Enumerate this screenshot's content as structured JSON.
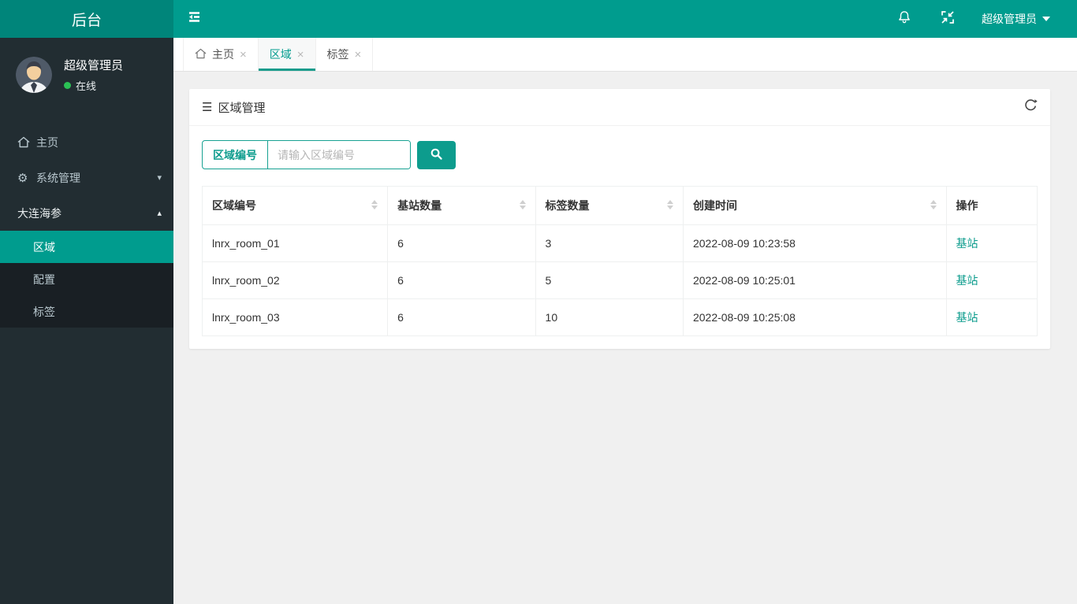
{
  "app": {
    "title": "后台"
  },
  "navbar": {
    "user_label": "超级管理员",
    "icons": {
      "menu_toggle": "outdent-lines",
      "notifications": "bell",
      "fullscreen": "compress-arrows",
      "user_caret": "caret-down"
    }
  },
  "sidebar": {
    "user": {
      "name": "超级管理员",
      "status": "在线"
    },
    "menu": [
      {
        "label": "主页",
        "icon": "home-icon"
      },
      {
        "label": "系统管理",
        "icon": "gear-icon",
        "caret": "down"
      },
      {
        "label": "大连海参",
        "caret": "up",
        "children": [
          {
            "label": "区域",
            "active": true
          },
          {
            "label": "配置",
            "active": false
          },
          {
            "label": "标签",
            "active": false
          }
        ]
      }
    ]
  },
  "tabs": [
    {
      "label": "主页",
      "home_icon": true,
      "active": false
    },
    {
      "label": "区域",
      "home_icon": false,
      "active": true
    },
    {
      "label": "标签",
      "home_icon": false,
      "active": false
    }
  ],
  "panel": {
    "title": "区域管理",
    "search": {
      "label": "区域编号",
      "placeholder": "请输入区域编号"
    },
    "table": {
      "columns": [
        {
          "label": "区域编号",
          "sortable": true
        },
        {
          "label": "基站数量",
          "sortable": true
        },
        {
          "label": "标签数量",
          "sortable": true
        },
        {
          "label": "创建时间",
          "sortable": true
        },
        {
          "label": "操作",
          "sortable": false
        }
      ],
      "rows": [
        {
          "region_id": "lnrx_room_01",
          "base_stations": "6",
          "tag_count": "3",
          "created_at": "2022-08-09 10:23:58",
          "action": "基站"
        },
        {
          "region_id": "lnrx_room_02",
          "base_stations": "6",
          "tag_count": "5",
          "created_at": "2022-08-09 10:25:01",
          "action": "基站"
        },
        {
          "region_id": "lnrx_room_03",
          "base_stations": "6",
          "tag_count": "10",
          "created_at": "2022-08-09 10:25:08",
          "action": "基站"
        }
      ]
    }
  },
  "glyphs": {
    "gear": "⚙",
    "panel_menu": "☰",
    "close": "×",
    "caret_down": "▾",
    "caret_up": "▴"
  },
  "colors": {
    "accent_teal": "#009c8e",
    "logo_teal": "#00857a",
    "sidebar_bg": "#222d32",
    "submenu_bg": "#191f24",
    "status_green": "#2bc155",
    "body_bg": "#f0f0f0",
    "link_teal": "#0d9c8d"
  }
}
